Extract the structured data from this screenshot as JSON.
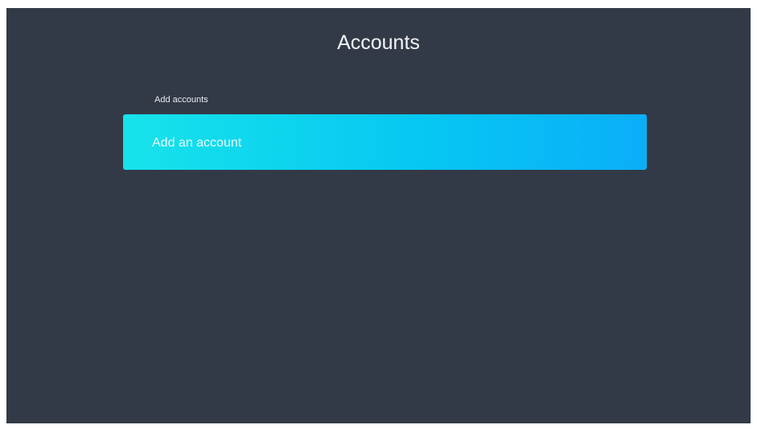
{
  "screen": {
    "title": "Accounts"
  },
  "add_accounts_section": {
    "label": "Add accounts",
    "button_label": "Add an account"
  },
  "colors": {
    "background": "#333a47",
    "accent_start": "#17e3ea",
    "accent_end": "#0aaef8",
    "text": "#f2f4f7"
  }
}
